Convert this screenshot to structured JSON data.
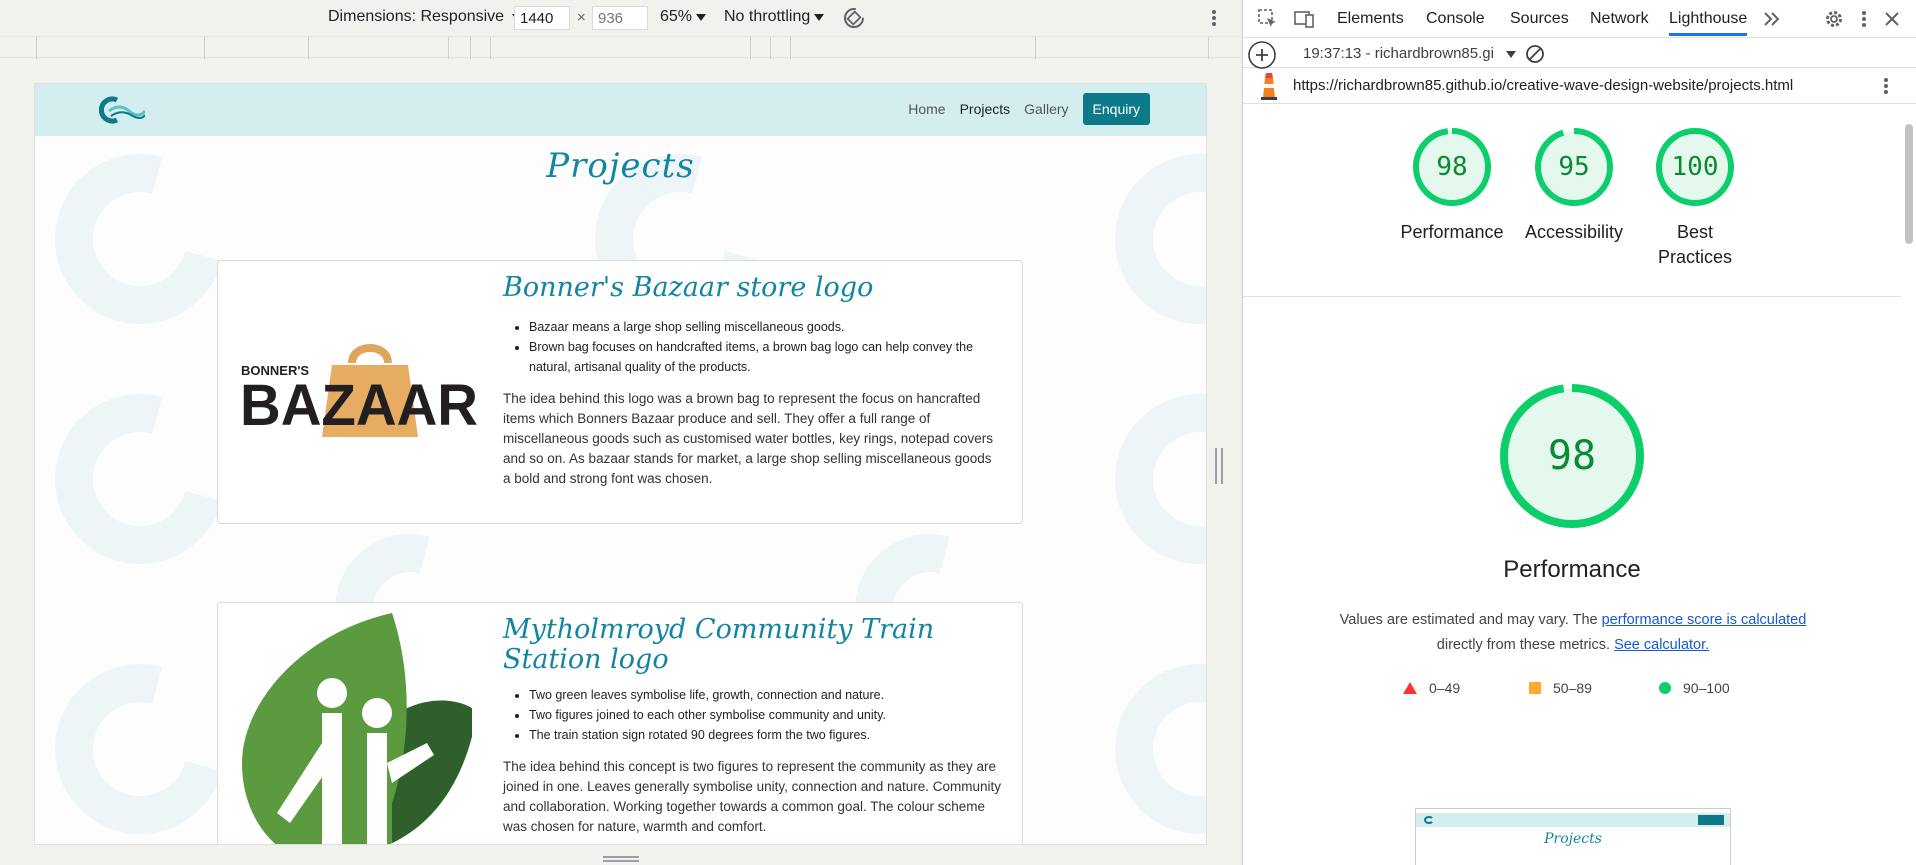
{
  "device_toolbar": {
    "dimensions_label": "Dimensions: Responsive",
    "width_value": "1440",
    "height_placeholder": "936",
    "times": "×",
    "zoom": "65%",
    "throttling": "No throttling"
  },
  "site": {
    "nav": {
      "home": "Home",
      "projects": "Projects",
      "gallery": "Gallery",
      "enquiry": "Enquiry"
    },
    "page_title": "Projects",
    "projects": [
      {
        "title": "Bonner's Bazaar store logo",
        "logo_text": {
          "top": "BONNER'S",
          "main": "BAZAAR"
        },
        "bullets": [
          "Bazaar means a large shop selling miscellaneous goods.",
          "Brown bag focuses on handcrafted items, a brown bag logo can help convey the natural, artisanal quality of the products."
        ],
        "description": "The idea behind this logo was a brown bag to represent the focus on hancrafted items which Bonners Bazaar produce and sell. They offer a full range of miscellaneous goods such as customised water bottles, key rings, notepad covers and so on. As bazaar stands for market, a large shop selling miscellaneous goods a bold and strong font was chosen."
      },
      {
        "title": "Mytholmroyd Community Train Station logo",
        "bullets": [
          "Two green leaves symbolise life, growth, connection and nature.",
          "Two figures joined to each other symbolise community and unity.",
          "The train station sign rotated 90 degrees form the two figures."
        ],
        "description": "The idea behind this concept is two figures to represent the community as they are joined in one. Leaves generally symbolise unity, connection and nature. Community and collaboration. Working together towards a common goal. The colour scheme was chosen for nature, warmth and comfort."
      }
    ]
  },
  "devtools": {
    "tabs": [
      "Elements",
      "Console",
      "Sources",
      "Network",
      "Lighthouse"
    ],
    "active_tab": "Lighthouse",
    "report_time": "19:37:13 - richardbrown85.gi",
    "url": "https://richardbrown85.github.io/creative-wave-design-website/projects.html",
    "scores": [
      {
        "label": "Performance",
        "value": "98",
        "fraction": 0.98
      },
      {
        "label": "Accessibility",
        "value": "95",
        "fraction": 0.95
      },
      {
        "label": "Best Practices",
        "value": "100",
        "fraction": 1.0
      }
    ],
    "performance": {
      "score": "98",
      "fraction": 0.98,
      "title": "Performance",
      "note_prefix": "Values are estimated and may vary. The ",
      "note_link": "performance score is calculated",
      "note_mid": "directly from these metrics. ",
      "note_link2": "See calculator."
    },
    "legend": [
      "0–49",
      "50–89",
      "90–100"
    ],
    "thumb_title": "Projects"
  },
  "colors": {
    "accent_teal": "#0d7a8a",
    "title_teal": "#1286a0",
    "gauge_green": "#0cce6b",
    "gauge_fill": "#e5f8ed",
    "fail_red": "#ff3333",
    "avg_orange": "#ffaa33"
  }
}
